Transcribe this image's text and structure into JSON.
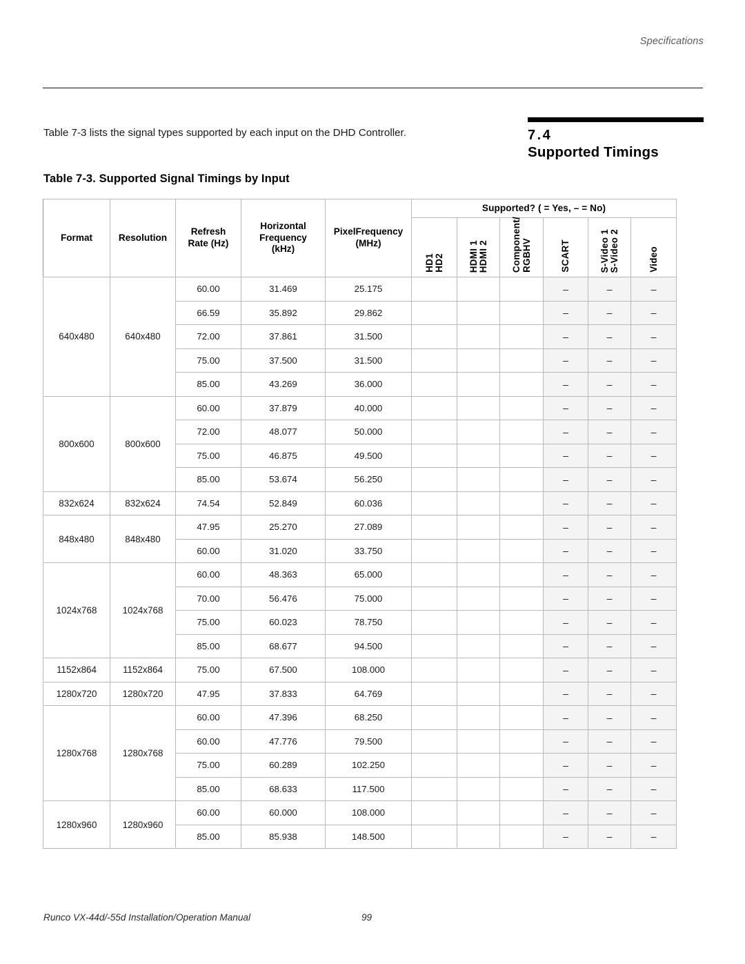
{
  "running_header": "Specifications",
  "section": {
    "number": "7.4",
    "title": "Supported Timings"
  },
  "intro": "Table 7-3 lists the signal types supported by each input on the DHD Controller.",
  "table_caption": "Table 7-3. Supported Signal Timings by Input",
  "table": {
    "supported_group_label": "Supported? (  = Yes, – = No)",
    "columns": [
      {
        "key": "format",
        "label": "Format"
      },
      {
        "key": "resolution",
        "label": "Resolution"
      },
      {
        "key": "refresh",
        "label": "Refresh\nRate (Hz)"
      },
      {
        "key": "hfreq",
        "label": "Horizontal\nFrequency\n(kHz)"
      },
      {
        "key": "pfreq",
        "label": "PixelFrequency\n(MHz)"
      }
    ],
    "column_labels": {
      "format": "Format",
      "resolution": "Resolution",
      "refresh_line1": "Refresh",
      "refresh_line2": "Rate (Hz)",
      "hfreq_line1": "Horizontal",
      "hfreq_line2": "Frequency",
      "hfreq_line3": "(kHz)",
      "pfreq_line1": "PixelFrequency",
      "pfreq_line2": "(MHz)"
    },
    "support_columns": [
      {
        "key": "hd",
        "lines": [
          "HD1",
          "HD2"
        ]
      },
      {
        "key": "hdmi",
        "lines": [
          "HDMI 1",
          "HDMI 2"
        ]
      },
      {
        "key": "component",
        "lines": [
          "Component/",
          "RGBHV"
        ]
      },
      {
        "key": "scart",
        "lines": [
          "SCART"
        ]
      },
      {
        "key": "svideo",
        "lines": [
          "S-Video 1",
          "S-Video 2"
        ]
      },
      {
        "key": "video",
        "lines": [
          "Video"
        ]
      }
    ],
    "dash": "–",
    "groups": [
      {
        "format": "640x480",
        "resolution": "640x480",
        "rows": [
          {
            "refresh": "60.00",
            "hfreq": "31.469",
            "pfreq": "25.175",
            "support": [
              "",
              "",
              "",
              "–",
              "–",
              "–"
            ]
          },
          {
            "refresh": "66.59",
            "hfreq": "35.892",
            "pfreq": "29.862",
            "support": [
              "",
              "",
              "",
              "–",
              "–",
              "–"
            ]
          },
          {
            "refresh": "72.00",
            "hfreq": "37.861",
            "pfreq": "31.500",
            "support": [
              "",
              "",
              "",
              "–",
              "–",
              "–"
            ]
          },
          {
            "refresh": "75.00",
            "hfreq": "37.500",
            "pfreq": "31.500",
            "support": [
              "",
              "",
              "",
              "–",
              "–",
              "–"
            ]
          },
          {
            "refresh": "85.00",
            "hfreq": "43.269",
            "pfreq": "36.000",
            "support": [
              "",
              "",
              "",
              "–",
              "–",
              "–"
            ]
          }
        ]
      },
      {
        "format": "800x600",
        "resolution": "800x600",
        "rows": [
          {
            "refresh": "60.00",
            "hfreq": "37.879",
            "pfreq": "40.000",
            "support": [
              "",
              "",
              "",
              "–",
              "–",
              "–"
            ]
          },
          {
            "refresh": "72.00",
            "hfreq": "48.077",
            "pfreq": "50.000",
            "support": [
              "",
              "",
              "",
              "–",
              "–",
              "–"
            ]
          },
          {
            "refresh": "75.00",
            "hfreq": "46.875",
            "pfreq": "49.500",
            "support": [
              "",
              "",
              "",
              "–",
              "–",
              "–"
            ]
          },
          {
            "refresh": "85.00",
            "hfreq": "53.674",
            "pfreq": "56.250",
            "support": [
              "",
              "",
              "",
              "–",
              "–",
              "–"
            ]
          }
        ]
      },
      {
        "format": "832x624",
        "resolution": "832x624",
        "rows": [
          {
            "refresh": "74.54",
            "hfreq": "52.849",
            "pfreq": "60.036",
            "support": [
              "",
              "",
              "",
              "–",
              "–",
              "–"
            ]
          }
        ]
      },
      {
        "format": "848x480",
        "resolution": "848x480",
        "rows": [
          {
            "refresh": "47.95",
            "hfreq": "25.270",
            "pfreq": "27.089",
            "support": [
              "",
              "",
              "",
              "–",
              "–",
              "–"
            ]
          },
          {
            "refresh": "60.00",
            "hfreq": "31.020",
            "pfreq": "33.750",
            "support": [
              "",
              "",
              "",
              "–",
              "–",
              "–"
            ]
          }
        ]
      },
      {
        "format": "1024x768",
        "resolution": "1024x768",
        "rows": [
          {
            "refresh": "60.00",
            "hfreq": "48.363",
            "pfreq": "65.000",
            "support": [
              "",
              "",
              "",
              "–",
              "–",
              "–"
            ]
          },
          {
            "refresh": "70.00",
            "hfreq": "56.476",
            "pfreq": "75.000",
            "support": [
              "",
              "",
              "",
              "–",
              "–",
              "–"
            ]
          },
          {
            "refresh": "75.00",
            "hfreq": "60.023",
            "pfreq": "78.750",
            "support": [
              "",
              "",
              "",
              "–",
              "–",
              "–"
            ]
          },
          {
            "refresh": "85.00",
            "hfreq": "68.677",
            "pfreq": "94.500",
            "support": [
              "",
              "",
              "",
              "–",
              "–",
              "–"
            ]
          }
        ]
      },
      {
        "format": "1152x864",
        "resolution": "1152x864",
        "rows": [
          {
            "refresh": "75.00",
            "hfreq": "67.500",
            "pfreq": "108.000",
            "support": [
              "",
              "",
              "",
              "–",
              "–",
              "–"
            ]
          }
        ]
      },
      {
        "format": "1280x720",
        "resolution": "1280x720",
        "rows": [
          {
            "refresh": "47.95",
            "hfreq": "37.833",
            "pfreq": "64.769",
            "support": [
              "",
              "",
              "",
              "–",
              "–",
              "–"
            ]
          }
        ]
      },
      {
        "format": "1280x768",
        "resolution": "1280x768",
        "rows": [
          {
            "refresh": "60.00",
            "hfreq": "47.396",
            "pfreq": "68.250",
            "support": [
              "",
              "",
              "",
              "–",
              "–",
              "–"
            ]
          },
          {
            "refresh": "60.00",
            "hfreq": "47.776",
            "pfreq": "79.500",
            "support": [
              "",
              "",
              "",
              "–",
              "–",
              "–"
            ]
          },
          {
            "refresh": "75.00",
            "hfreq": "60.289",
            "pfreq": "102.250",
            "support": [
              "",
              "",
              "",
              "–",
              "–",
              "–"
            ]
          },
          {
            "refresh": "85.00",
            "hfreq": "68.633",
            "pfreq": "117.500",
            "support": [
              "",
              "",
              "",
              "–",
              "–",
              "–"
            ]
          }
        ]
      },
      {
        "format": "1280x960",
        "resolution": "1280x960",
        "rows": [
          {
            "refresh": "60.00",
            "hfreq": "60.000",
            "pfreq": "108.000",
            "support": [
              "",
              "",
              "",
              "–",
              "–",
              "–"
            ]
          },
          {
            "refresh": "85.00",
            "hfreq": "85.938",
            "pfreq": "148.500",
            "support": [
              "",
              "",
              "",
              "–",
              "–",
              "–"
            ]
          }
        ]
      }
    ]
  },
  "footer": {
    "manual": "Runco VX-44d/-55d Installation/Operation Manual",
    "page_number": "99"
  }
}
